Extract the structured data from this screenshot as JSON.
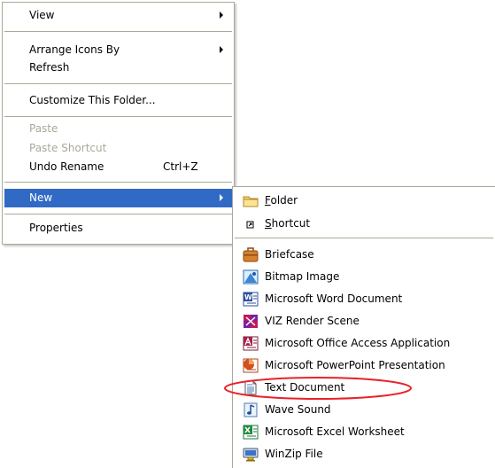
{
  "main_menu": {
    "view": "View",
    "arrange": "Arrange Icons By",
    "refresh": "Refresh",
    "customize": "Customize This Folder...",
    "paste": "Paste",
    "paste_shortcut": "Paste Shortcut",
    "undo_rename": "Undo Rename",
    "undo_shortcut": "Ctrl+Z",
    "new": "New",
    "properties": "Properties"
  },
  "new_submenu": {
    "folder_mnemonic": "F",
    "folder_rest": "older",
    "shortcut_mnemonic": "S",
    "shortcut_rest": "hortcut",
    "items": [
      {
        "label": "Briefcase",
        "icon": "briefcase-icon"
      },
      {
        "label": "Bitmap Image",
        "icon": "bitmap-icon"
      },
      {
        "label": "Microsoft Word Document",
        "icon": "word-icon"
      },
      {
        "label": "VIZ Render Scene",
        "icon": "viz-render-icon"
      },
      {
        "label": "Microsoft Office Access Application",
        "icon": "access-icon"
      },
      {
        "label": "Microsoft PowerPoint Presentation",
        "icon": "powerpoint-icon"
      },
      {
        "label": "Text Document",
        "icon": "text-document-icon"
      },
      {
        "label": "Wave Sound",
        "icon": "wave-sound-icon"
      },
      {
        "label": "Microsoft Excel Worksheet",
        "icon": "excel-icon"
      },
      {
        "label": "WinZip File",
        "icon": "winzip-icon"
      }
    ]
  },
  "colors": {
    "highlight": "#316ac5",
    "disabled_text": "#aca899",
    "annotation_ring": "#e8222a"
  }
}
